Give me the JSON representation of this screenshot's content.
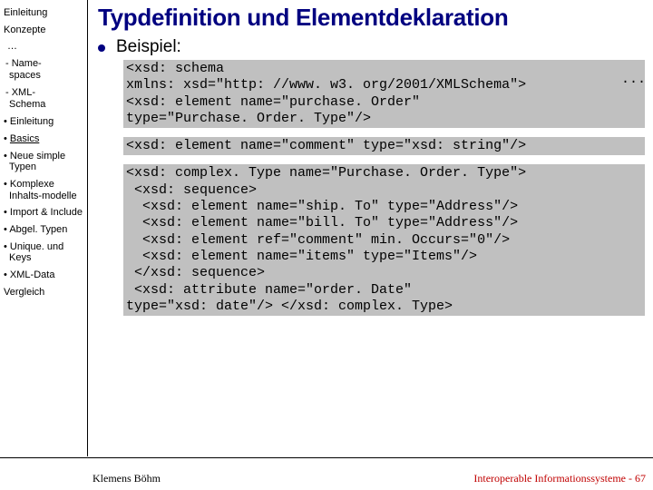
{
  "sidebar": {
    "items": [
      "Einleitung",
      "Konzepte"
    ],
    "ellipsis": "…",
    "sub": [
      "- Name-\n  spaces",
      "- XML-\n  Schema"
    ],
    "bullets": [
      {
        "text": "Einleitung",
        "link": false
      },
      {
        "text": "Basics",
        "link": true
      },
      {
        "text": "Neue simple Typen",
        "link": false
      },
      {
        "text": "Komplexe Inhalts-modelle",
        "link": false
      },
      {
        "text": "Import & Include",
        "link": false
      },
      {
        "text": "Abgel. Typen",
        "link": false
      },
      {
        "text": "Unique. und Keys",
        "link": false
      },
      {
        "text": "XML-Data",
        "link": false
      }
    ],
    "bottom": "Vergleich"
  },
  "main": {
    "title": "Typdefinition und Elementdeklaration",
    "label": "Beispiel:",
    "ellipsis": "...",
    "code1": "<xsd: schema\nxmlns: xsd=\"http: //www. w3. org/2001/XMLSchema\">\n<xsd: element name=\"purchase. Order\"\ntype=\"Purchase. Order. Type\"/>",
    "code2": "<xsd: element name=\"comment\" type=\"xsd: string\"/>",
    "code3": "<xsd: complex. Type name=\"Purchase. Order. Type\">\n <xsd: sequence>\n  <xsd: element name=\"ship. To\" type=\"Address\"/>\n  <xsd: element name=\"bill. To\" type=\"Address\"/>\n  <xsd: element ref=\"comment\" min. Occurs=\"0\"/>\n  <xsd: element name=\"items\" type=\"Items\"/>\n </xsd: sequence>\n <xsd: attribute name=\"order. Date\"\ntype=\"xsd: date\"/> </xsd: complex. Type>"
  },
  "footer": {
    "left": "Klemens Böhm",
    "right": "Interoperable Informationssysteme - 67"
  }
}
